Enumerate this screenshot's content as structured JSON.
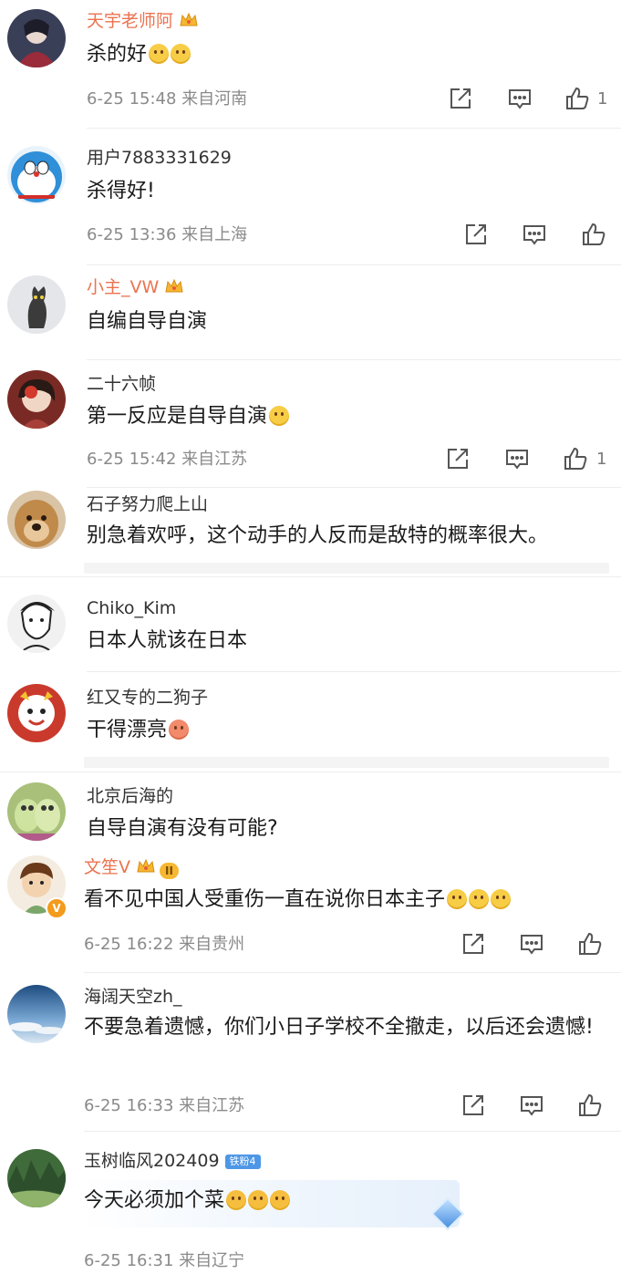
{
  "colors": {
    "vip_name": "#eb7350",
    "name": "#333333",
    "text": "#1a1a1a",
    "meta": "#8a8a8a"
  },
  "comments": [
    {
      "user": "天宇老师阿",
      "text": "杀的好",
      "meta": "6-25 15:48 来自河南",
      "likes": "1"
    },
    {
      "user": "用户7883331629",
      "text": "杀得好!",
      "meta": "6-25 13:36 来自上海"
    },
    {
      "user": "小主_VW",
      "text": "自编自导自演"
    },
    {
      "user": "二十六帧",
      "text": "第一反应是自导自演",
      "meta": "6-25 15:42 来自江苏",
      "likes": "1"
    },
    {
      "user": "石子努力爬上山",
      "text": "别急着欢呼，这个动手的人反而是敌特的概率很大。"
    },
    {
      "user": "Chiko_Kim",
      "text": "日本人就该在日本"
    },
    {
      "user": "红又专的二狗子",
      "text": "干得漂亮"
    },
    {
      "user": "北京后海的",
      "text": "自导自演有没有可能?"
    },
    {
      "user": "文笙V",
      "vip_badge": "II",
      "text": "看不见中国人受重伤一直在说你日本主子",
      "meta": "6-25 16:22 来自贵州"
    },
    {
      "user": "海阔天空zh_",
      "text": "不要急着遗憾，你们小日子学校不全撤走，以后还会遗憾!",
      "meta": "6-25 16:33 来自江苏"
    },
    {
      "user": "玉树临风202409",
      "fan_badge": "铁粉4",
      "text": "今天必须加个菜",
      "meta": "6-25 16:31 来自辽宁"
    }
  ]
}
